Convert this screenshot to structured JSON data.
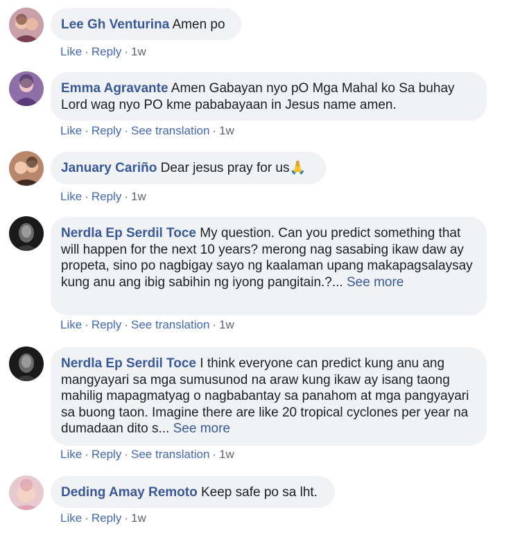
{
  "comments": [
    {
      "author": "Lee Gh Venturina",
      "text": "Amen po",
      "actions": [
        "Like",
        "Reply"
      ],
      "time": "1w"
    },
    {
      "author": "Emma Agravante",
      "text": "Amen Gabayan nyo pO Mga Mahal ko Sa buhay Lord wag nyo PO kme pababayaan in Jesus name amen.",
      "actions": [
        "Like",
        "Reply",
        "See translation"
      ],
      "time": "1w"
    },
    {
      "author": "January Cariño",
      "text": "Dear jesus pray for us",
      "emoji": "🙏",
      "actions": [
        "Like",
        "Reply"
      ],
      "time": "1w"
    },
    {
      "author": "Nerdla Ep Serdil Toce",
      "text": "My question. Can you predict something that will happen for the next 10 years? merong nag sasabing ikaw daw ay propeta, sino po nagbigay sayo ng kaalaman upang makapagsalaysay kung anu ang ibig sabihin ng iyong pangitain.?...",
      "see_more": "See more",
      "actions": [
        "Like",
        "Reply",
        "See translation"
      ],
      "time": "1w"
    },
    {
      "author": "Nerdla Ep Serdil Toce",
      "text": "I think everyone can predict kung anu ang mangyayari sa mga sumusunod na araw kung ikaw ay isang taong mahilig mapagmatyag o nagbabantay sa panahom at mga pangyayari sa buong taon. Imagine there are like 20 tropical cyclones per year na dumadaan dito s...",
      "see_more": "See more",
      "actions": [
        "Like",
        "Reply",
        "See translation"
      ],
      "time": "1w"
    },
    {
      "author": "Deding Amay Remoto",
      "text": "Keep safe po sa lht.",
      "actions": [
        "Like",
        "Reply"
      ],
      "time": "1w"
    }
  ],
  "colors": {
    "bubble": "#f0f2f5",
    "author": "#385898",
    "action": "#4267b2",
    "meta": "#606770"
  }
}
